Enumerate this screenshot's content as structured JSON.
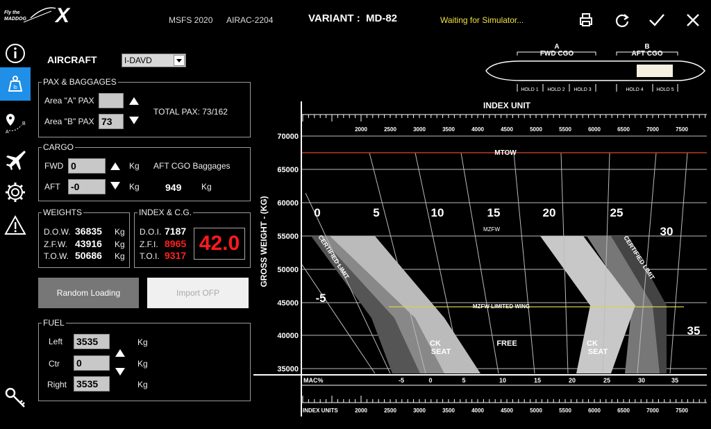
{
  "header": {
    "logo_small": "Fly the MADDOG",
    "logo_x": "X",
    "sim": "MSFS 2020",
    "airac": "AIRAC-2204",
    "variant_label": "VARIANT :",
    "variant_value": "MD-82",
    "status": "Waiting for Simulator...",
    "status_color": "#f0e040"
  },
  "aircraft": {
    "label": "AIRCRAFT",
    "selected": "I-DAVD"
  },
  "pax": {
    "title": "PAX & BAGGAGES",
    "area_a_label": "Area \"A\" PAX",
    "area_a_value": "",
    "area_b_label": "Area \"B\" PAX",
    "area_b_value": "73",
    "total_label": "TOTAL PAX: 73/162"
  },
  "cargo": {
    "title": "CARGO",
    "fwd_label": "FWD",
    "fwd_value": "0",
    "fwd_unit": "Kg",
    "aft_label": "AFT",
    "aft_value": "-0",
    "aft_unit": "Kg",
    "baggage_label": "AFT CGO Baggages",
    "baggage_value": "949",
    "baggage_unit": "Kg"
  },
  "weights": {
    "title": "WEIGHTS",
    "rows": [
      {
        "label": "D.O.W.",
        "value": "36835",
        "unit": "Kg"
      },
      {
        "label": "Z.F.W.",
        "value": "43916",
        "unit": "Kg"
      },
      {
        "label": "T.O.W.",
        "value": "50686",
        "unit": "Kg"
      }
    ]
  },
  "index": {
    "title": "INDEX & C.G.",
    "doi_label": "D.O.I.",
    "doi_value": "7187",
    "zfi_label": "Z.F.I.",
    "zfi_value": "8965",
    "toi_label": "T.O.I.",
    "toi_value": "9317",
    "cg_value": "42.0"
  },
  "buttons": {
    "random": "Random Loading",
    "import": "Import OFP"
  },
  "fuel": {
    "title": "FUEL",
    "left_label": "Left",
    "left_value": "3535",
    "ctr_label": "Ctr",
    "ctr_value": "0",
    "right_label": "Right",
    "right_value": "3535",
    "unit": "Kg"
  },
  "icons": {
    "side": [
      "info-icon",
      "loadsheet-icon",
      "route-icon",
      "aircraft-icon",
      "settings-icon",
      "warning-icon",
      "key-icon"
    ],
    "top": [
      "print-icon",
      "refresh-icon",
      "check-icon",
      "close-icon"
    ]
  },
  "fuselage": {
    "a_letter": "A",
    "b_letter": "B",
    "fwd_cgo": "FWD CGO",
    "aft_cgo": "AFT CGO",
    "holds": [
      "HOLD 1",
      "HOLD 2",
      "HOLD 3",
      "HOLD 4",
      "HOLD 5"
    ]
  },
  "chart_data": {
    "type": "table",
    "title": "INDEX UNIT",
    "ylabel": "GROSS WEIGHT - (KG)",
    "y_ticks": [
      "70000",
      "65000",
      "60000",
      "55000",
      "50000",
      "45000",
      "40000",
      "35000"
    ],
    "index_ticks_top": [
      "2000",
      "2500",
      "3000",
      "3500",
      "4000",
      "4500",
      "5000",
      "5500",
      "6000",
      "6500",
      "7000",
      "7500"
    ],
    "index_ticks_bottom": [
      "2000",
      "2500",
      "3000",
      "3500",
      "4000",
      "4500",
      "5000",
      "5500",
      "6000",
      "6500",
      "7000",
      "7500"
    ],
    "index_units_label": "INDEX UNITS",
    "mac_label": "MAC%",
    "mac_ticks": [
      "-5",
      "0",
      "5",
      "10",
      "15",
      "20",
      "25",
      "30",
      "35"
    ],
    "mac_lines": [
      "0",
      "5",
      "10",
      "15",
      "20",
      "25",
      "30",
      "35",
      "-5"
    ],
    "labels": {
      "mtow": "MTOW",
      "mzfw": "MZFW",
      "mzfw_wing": "MZFW LIMITED WING",
      "cert_left": "CERTIFIED LIMIT",
      "cert_right": "CERTIFIED LIMIT",
      "ck_seat_1": "CK",
      "ck_seat_2": "SEAT",
      "free": "FREE"
    },
    "mtow_kg": 67500,
    "mzfw_kg": 55300,
    "mzfw_wing_kg": 44300
  }
}
